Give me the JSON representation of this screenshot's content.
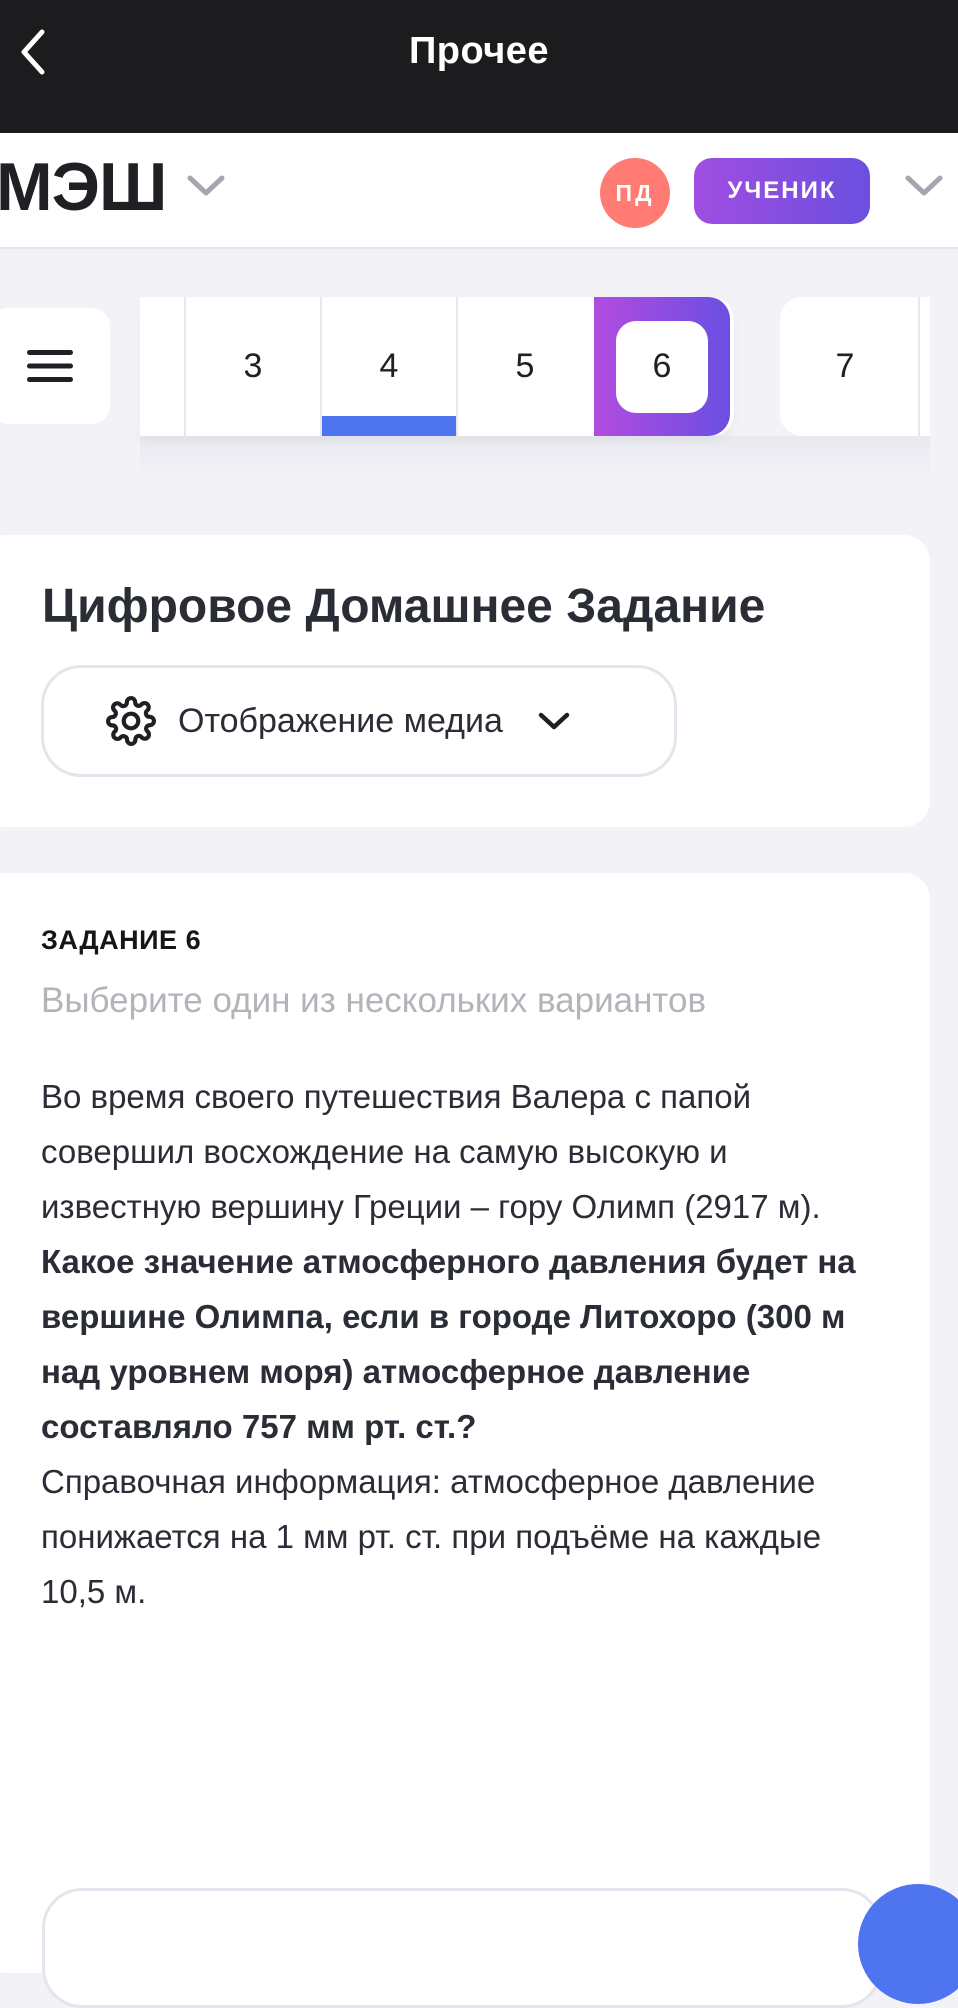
{
  "topbar": {
    "title": "Прочее"
  },
  "header": {
    "logo": "МЭШ",
    "avatar_initials": "ПД",
    "role": "УЧЕНИК"
  },
  "task_strip": {
    "cells": [
      "3",
      "4",
      "5",
      "6",
      "7"
    ],
    "active": "6",
    "completed": "4"
  },
  "main": {
    "page_title": "Цифровое Домашнее Задание",
    "media_button_label": "Отображение медиа"
  },
  "task": {
    "label": "ЗАДАНИЕ 6",
    "hint": "Выберите один из нескольких вариантов",
    "intro": "Во время своего путешествия Валера с папой совершил восхождение на самую высокую и известную вершину Греции – гору Олимп (2917 м).",
    "question": "Какое значение атмосферного давления будет на вершине Олимпа, если в городе Литохоро (300 м над уровнем моря) атмосферное давление составляло 757 мм рт. ст.?",
    "reference": "Справочная информация: атмосферное давление понижается на 1 мм рт. ст. при подъёме на каждые 10,5 м."
  },
  "colors": {
    "topbar_bg": "#1c1c1e",
    "avatar": "#ff7b73",
    "accent_purple": "#8a4de0",
    "accent_blue": "#4f74f0",
    "page_bg": "#f2f2f7"
  }
}
